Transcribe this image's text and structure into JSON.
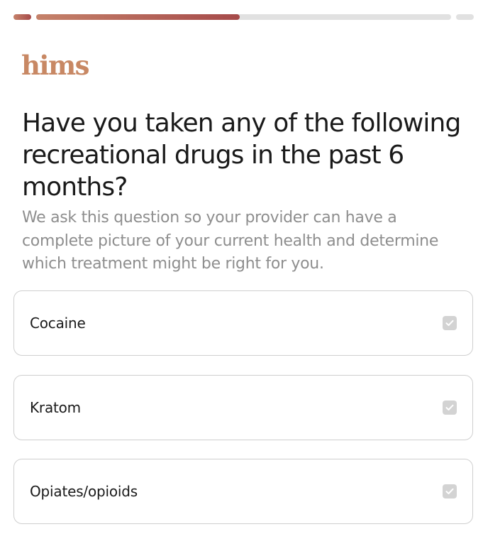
{
  "progress": {
    "segments": [
      {
        "fill": 1.0
      },
      {
        "fill": 0.49
      },
      {
        "fill": 0.0
      }
    ],
    "accent_colors": [
      "#c5826a",
      "#a64a4a"
    ],
    "track_color": "#e1e1e1"
  },
  "header": {
    "logo_text": "hims",
    "logo_color": "#c88864"
  },
  "main": {
    "question": "Have you taken any of the following recreational drugs in the past 6 months?",
    "subtext": "We ask this question so your provider can have a complete picture of your current health and determine which treatment might be right for you.",
    "options": [
      {
        "label": "Cocaine",
        "checked": false,
        "icon": "check-icon"
      },
      {
        "label": "Kratom",
        "checked": false,
        "icon": "check-icon"
      },
      {
        "label": "Opiates/opioids",
        "checked": false,
        "icon": "check-icon"
      }
    ]
  }
}
